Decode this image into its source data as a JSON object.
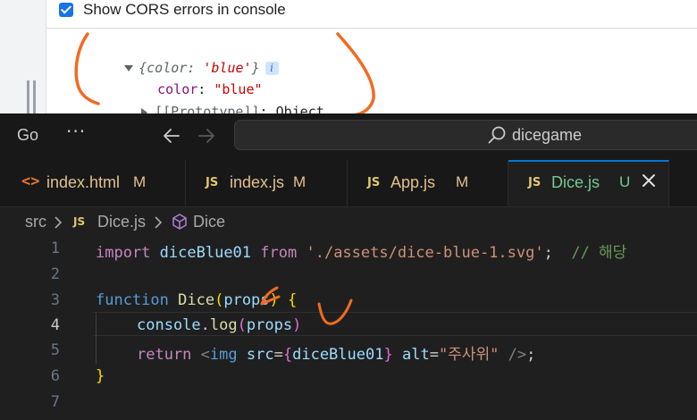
{
  "devtools": {
    "checkbox_label": "Show CORS errors in console",
    "object_summary_open": "{",
    "object_summary_key": "color",
    "object_summary_sep": ": ",
    "object_summary_value": "'blue'",
    "object_summary_close": "}",
    "info_badge": "i",
    "prop_key": "color",
    "prop_sep": ": ",
    "prop_value": "\"blue\"",
    "proto_key": "[[Prototype]]",
    "proto_sep": ": ",
    "proto_value": "Object"
  },
  "titlebar": {
    "menu_go": "Go",
    "menu_more": "···",
    "search_text": "dicegame"
  },
  "tabs": [
    {
      "icon": "<>",
      "label": "index.html",
      "status": "M",
      "active": false
    },
    {
      "icon": "JS",
      "label": "index.js",
      "status": "M",
      "active": false
    },
    {
      "icon": "JS",
      "label": "App.js",
      "status": "M",
      "active": false
    },
    {
      "icon": "JS",
      "label": "Dice.js",
      "status": "U",
      "active": true
    }
  ],
  "breadcrumb": {
    "folder": "src",
    "file_icon": "JS",
    "file": "Dice.js",
    "symbol": "Dice"
  },
  "editor": {
    "line_numbers": [
      "1",
      "2",
      "3",
      "4",
      "5",
      "6",
      "7"
    ],
    "current_line": "4",
    "line1": {
      "kw_import": "import",
      "ident": "diceBlue01",
      "kw_from": "from",
      "path": "'./assets/dice-blue-1.svg'",
      "semi": ";",
      "comment": "// 해당"
    },
    "line3": {
      "kw_function": "function",
      "fn_name": "Dice",
      "paren_open": "(",
      "param": "props",
      "paren_close": ")",
      "brace": "{"
    },
    "line4": {
      "obj": "console",
      "dot": ".",
      "method": "log",
      "paren_open": "(",
      "arg": "props",
      "paren_close": ")"
    },
    "line5": {
      "kw_return": "return",
      "lt": "<",
      "tag": "img",
      "attr_src": "src",
      "eq": "=",
      "brace_open": "{",
      "src_value": "diceBlue01",
      "brace_close": "}",
      "attr_alt": "alt",
      "alt_value": "\"주사위\"",
      "end": "/>",
      "semi": ";"
    },
    "line6": {
      "brace": "}"
    }
  },
  "colors": {
    "accent": "#0078d4",
    "annotation": "#f26a21"
  }
}
